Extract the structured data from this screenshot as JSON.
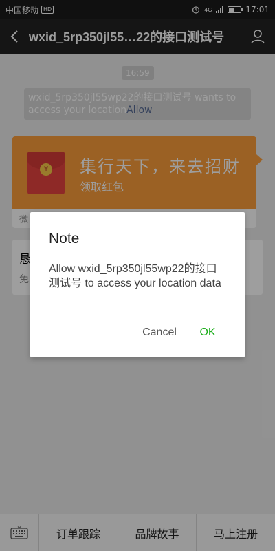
{
  "status_bar": {
    "carrier": "中国移动",
    "hd_label": "HD",
    "network": "4G",
    "time": "17:01",
    "icons": [
      "alarm-icon",
      "signal-icon",
      "battery-icon"
    ]
  },
  "title_bar": {
    "title": "wxid_5rp350jl55…22的接口测试号",
    "back_icon": "back-arrow-icon",
    "profile_icon": "person-icon"
  },
  "chat": {
    "timestamp": "16:59",
    "system_message": "wxid_5rp350jl55wp22的接口测试号 wants to access your location",
    "system_message_action": "Allow",
    "red_packet": {
      "title": "集行天下，来去招财",
      "subtitle": "领取红包",
      "footer": "微"
    },
    "link_card": {
      "title": "恳",
      "subtitle": "免"
    }
  },
  "dialog": {
    "title": "Note",
    "message": "Allow wxid_5rp350jl55wp22的接口测试号 to access your location data",
    "cancel_label": "Cancel",
    "ok_label": "OK",
    "ok_color": "#1aad19"
  },
  "bottom_menu": {
    "keyboard_icon": "keyboard-icon",
    "items": [
      {
        "label": "订单跟踪"
      },
      {
        "label": "品牌故事"
      },
      {
        "label": "马上注册"
      }
    ]
  }
}
